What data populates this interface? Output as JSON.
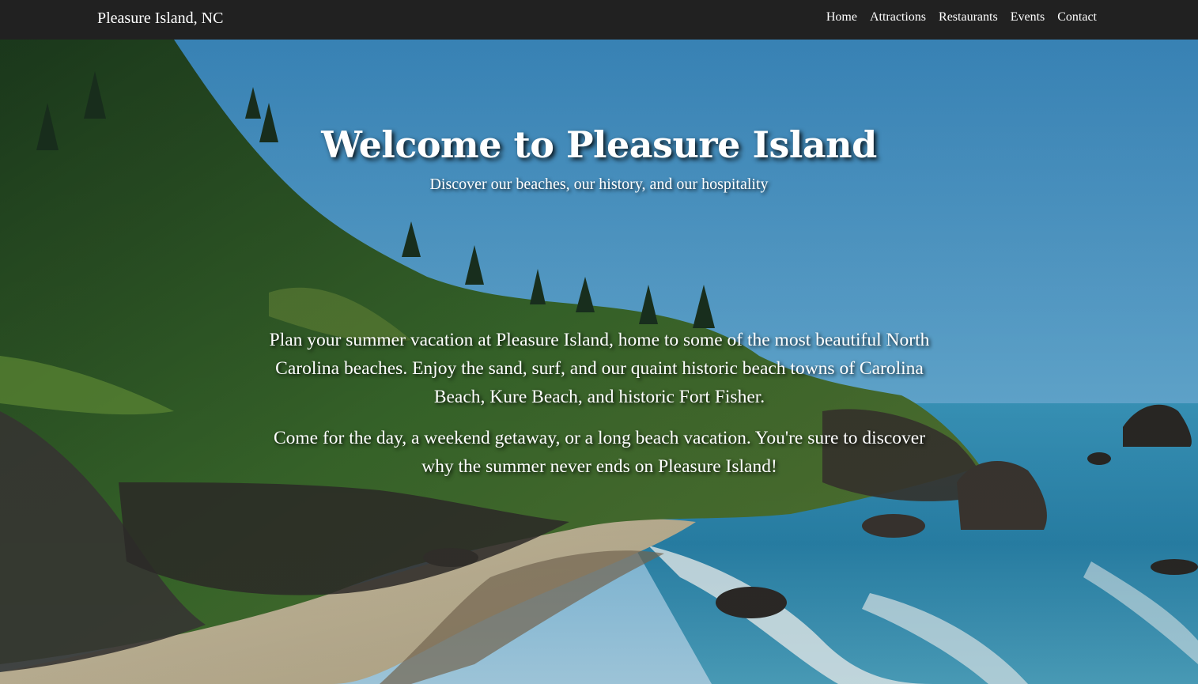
{
  "nav": {
    "brand": "Pleasure Island, NC",
    "links": [
      "Home",
      "Attractions",
      "Restaurants",
      "Events",
      "Contact"
    ]
  },
  "hero": {
    "title": "Welcome to Pleasure Island",
    "subtitle": "Discover our beaches, our history, and our hospitality",
    "paragraphs": [
      "Plan your summer vacation at Pleasure Island, home to some of the most beautiful North Carolina beaches. Enjoy the sand, surf, and our quaint historic beach towns of Carolina Beach, Kure Beach, and historic Fort Fisher.",
      "Come for the day, a weekend getaway, or a long beach vacation. You're sure to discover why the summer never ends on Pleasure Island!"
    ]
  },
  "colors": {
    "navbar": "#212121",
    "sky": "#5aa8d8",
    "ocean": "#2f8fb8",
    "sand": "#cbbf9f",
    "forest": "#2e5a2a"
  },
  "background_image": "coastal beach with forested cliffs and rocky shoreline"
}
